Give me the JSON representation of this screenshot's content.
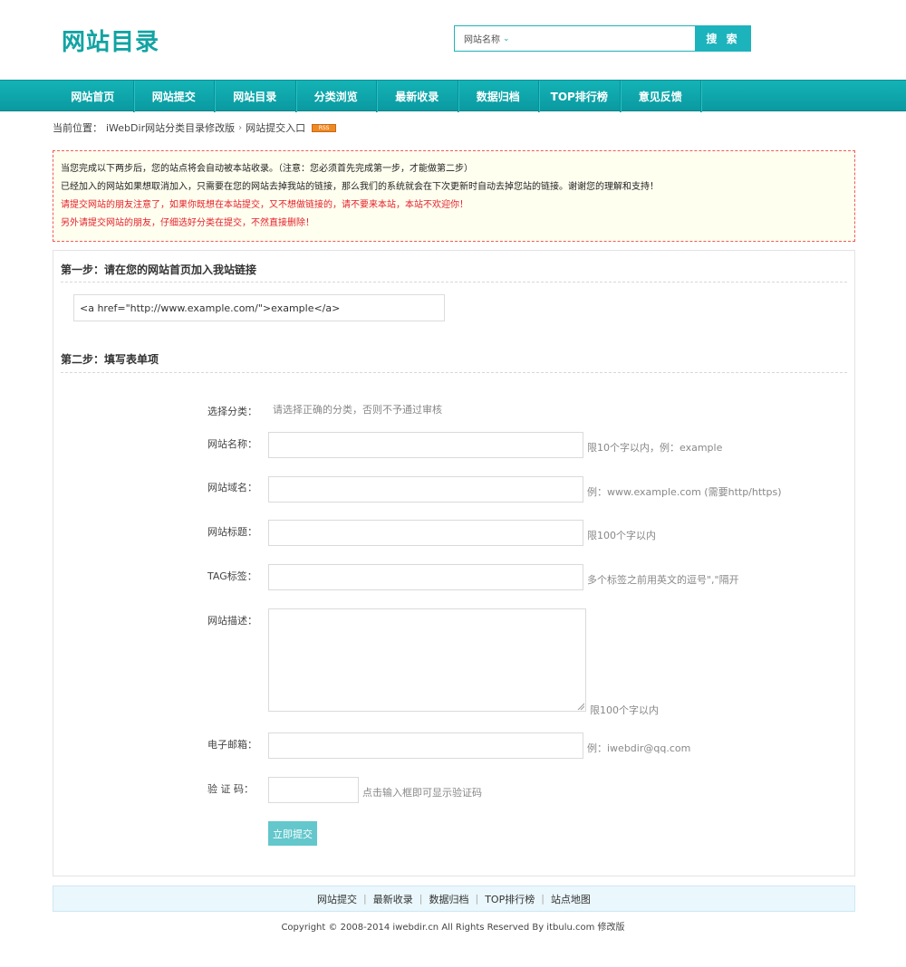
{
  "header": {
    "logo": "网站目录",
    "search_type": "网站名称",
    "search_button": "搜 索"
  },
  "nav": [
    "网站首页",
    "网站提交",
    "网站目录",
    "分类浏览",
    "最新收录",
    "数据归档",
    "TOP排行榜",
    "意见反馈"
  ],
  "breadcrumb": {
    "prefix": "当前位置：",
    "site": "iWebDir网站分类目录修改版",
    "separator": "›",
    "current": "网站提交入口",
    "rss": "RSS"
  },
  "notice": {
    "line1": "当您完成以下两步后，您的站点将会自动被本站收录。（注意：您必须首先完成第一步，才能做第二步）",
    "line2": "已经加入的网站如果想取消加入，只需要在您的网站去掉我站的链接，那么我们的系统就会在下次更新时自动去掉您站的链接。谢谢您的理解和支持！",
    "line3": "请提交网站的朋友注意了，如果你既想在本站提交，又不想做链接的，请不要来本站，本站不欢迎你！",
    "line4": "另外请提交网站的朋友，仔细选好分类在提交，不然直接删除！"
  },
  "step1": {
    "title": "第一步：请在您的网站首页加入我站链接",
    "code": "<a href=\"http://www.example.com/\">example</a>"
  },
  "step2": {
    "title": "第二步：填写表单项",
    "category_label": "选择分类：",
    "category_hint": "请选择正确的分类，否则不予通过审核",
    "name_label": "网站名称：",
    "name_hint": "限10个字以内，例：example",
    "domain_label": "网站域名：",
    "domain_hint": "例：www.example.com (需要http/https)",
    "title_label": "网站标题：",
    "title_hint": "限100个字以内",
    "tag_label": "TAG标签：",
    "tag_hint": "多个标签之前用英文的逗号\",\"隔开",
    "desc_label": "网站描述：",
    "desc_hint": "限100个字以内",
    "email_label": "电子邮箱：",
    "email_hint": "例：iwebdir@qq.com",
    "captcha_label": "验 证 码：",
    "captcha_hint": "点击输入框即可显示验证码",
    "submit": "立即提交"
  },
  "footer": {
    "links": [
      "网站提交",
      "最新收录",
      "数据归档",
      "TOP排行榜",
      "站点地图"
    ],
    "copyright": "Copyright © 2008-2014 iwebdir.cn All Rights Reserved By itbulu.com 修改版"
  }
}
